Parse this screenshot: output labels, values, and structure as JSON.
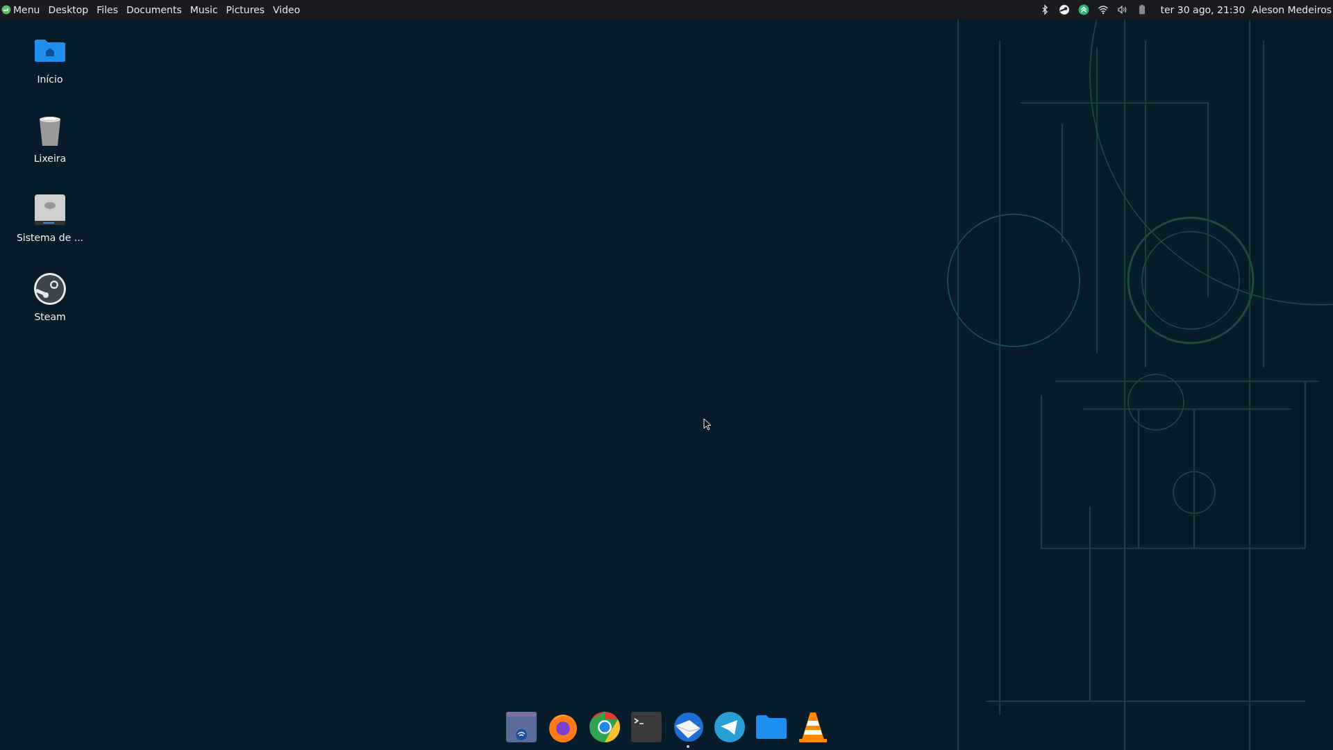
{
  "top_bar": {
    "menu_label": "Menu",
    "places": [
      "Desktop",
      "Files",
      "Documents",
      "Music",
      "Pictures",
      "Video"
    ],
    "tray": [
      {
        "kind": "bluetooth"
      },
      {
        "kind": "steam"
      },
      {
        "kind": "update"
      },
      {
        "kind": "wifi"
      },
      {
        "kind": "volume"
      },
      {
        "kind": "battery"
      }
    ],
    "clock": "ter 30 ago, 21:30",
    "user": "Aleson Medeiros"
  },
  "desktop_icons": [
    {
      "kind": "home",
      "label": "Início"
    },
    {
      "kind": "trash",
      "label": "Lixeira"
    },
    {
      "kind": "drive",
      "label": "Sistema de ..."
    },
    {
      "kind": "steam",
      "label": "Steam"
    }
  ],
  "dock": [
    {
      "kind": "network",
      "running": false
    },
    {
      "kind": "firefox",
      "running": false
    },
    {
      "kind": "chrome",
      "running": false
    },
    {
      "kind": "terminal",
      "running": false
    },
    {
      "kind": "mail",
      "running": true
    },
    {
      "kind": "telegram",
      "running": false
    },
    {
      "kind": "folder",
      "running": false
    },
    {
      "kind": "vlc",
      "running": false
    }
  ]
}
